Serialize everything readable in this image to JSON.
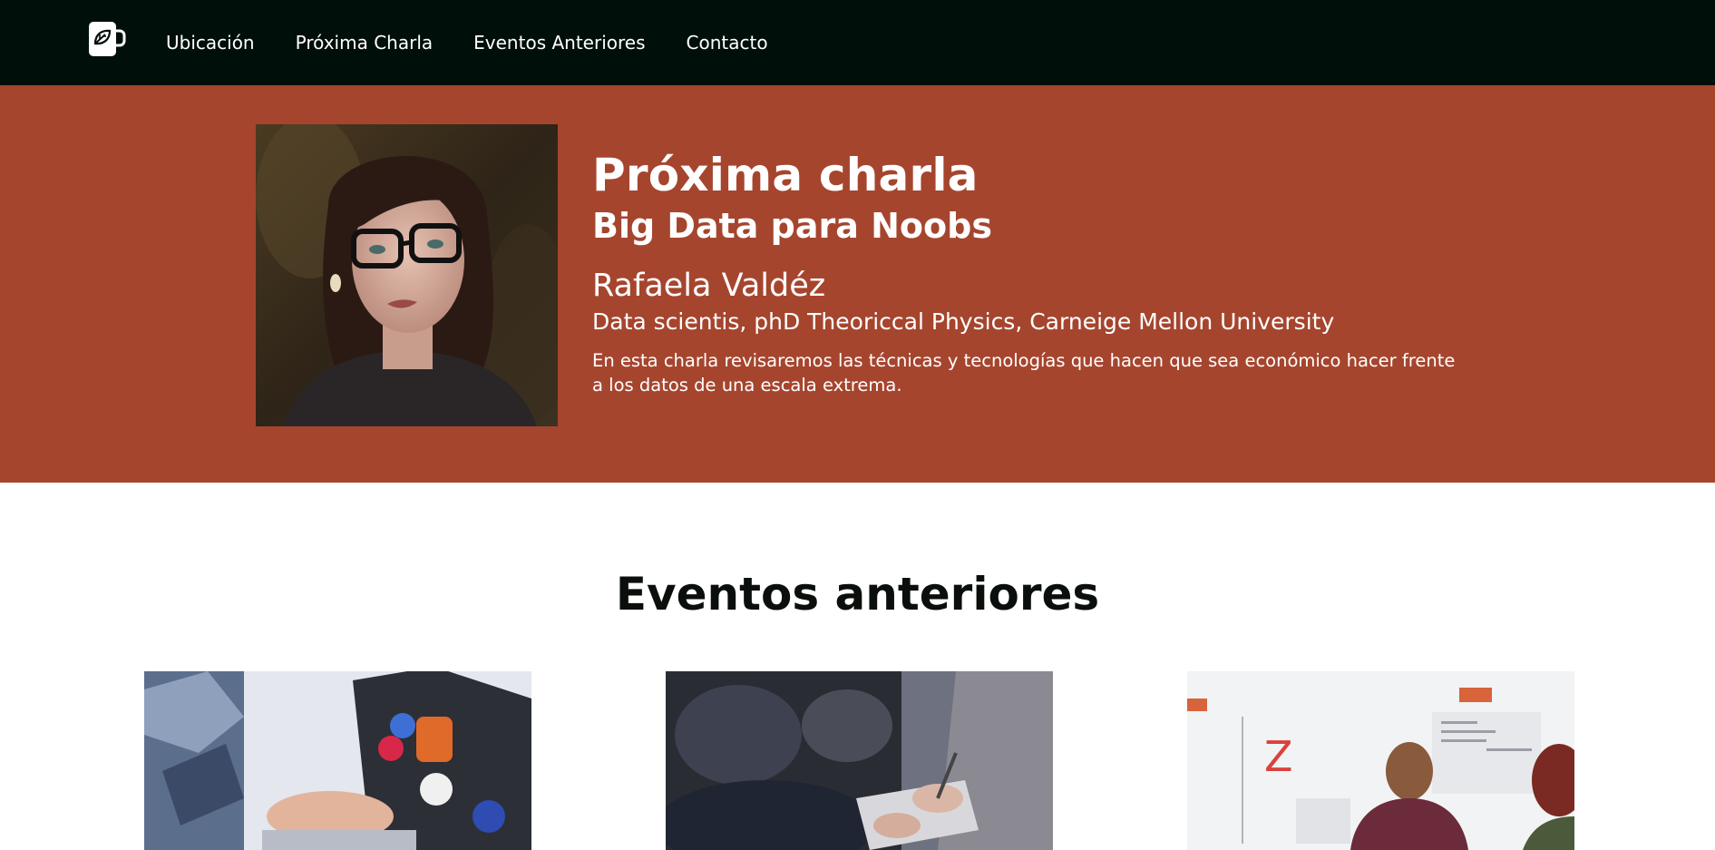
{
  "nav": {
    "logo": "mug-leaf-logo",
    "links": [
      "Ubicación",
      "Próxima Charla",
      "Eventos Anteriores",
      "Contacto"
    ]
  },
  "hero": {
    "title": "Próxima charla",
    "talk_title": "Big Data para Noobs",
    "speaker_name": "Rafaela Valdéz",
    "speaker_credentials": "Data scientis, phD Theoriccal Physics, Carneige Mellon University",
    "description": "En esta charla revisaremos las técnicas y tecnologías que hacen que sea económico hacer frente a los datos de una escala extrema.",
    "background_color": "#a6452e"
  },
  "past_events": {
    "title": "Eventos anteriores",
    "cards": [
      {
        "image": "laptop-with-stickers-photo"
      },
      {
        "image": "audience-taking-notes-photo"
      },
      {
        "image": "whiteboard-meeting-photo"
      }
    ]
  },
  "colors": {
    "nav_background": "#010f0a",
    "hero_background": "#a6452e",
    "text_dark": "#0a0f0c"
  }
}
